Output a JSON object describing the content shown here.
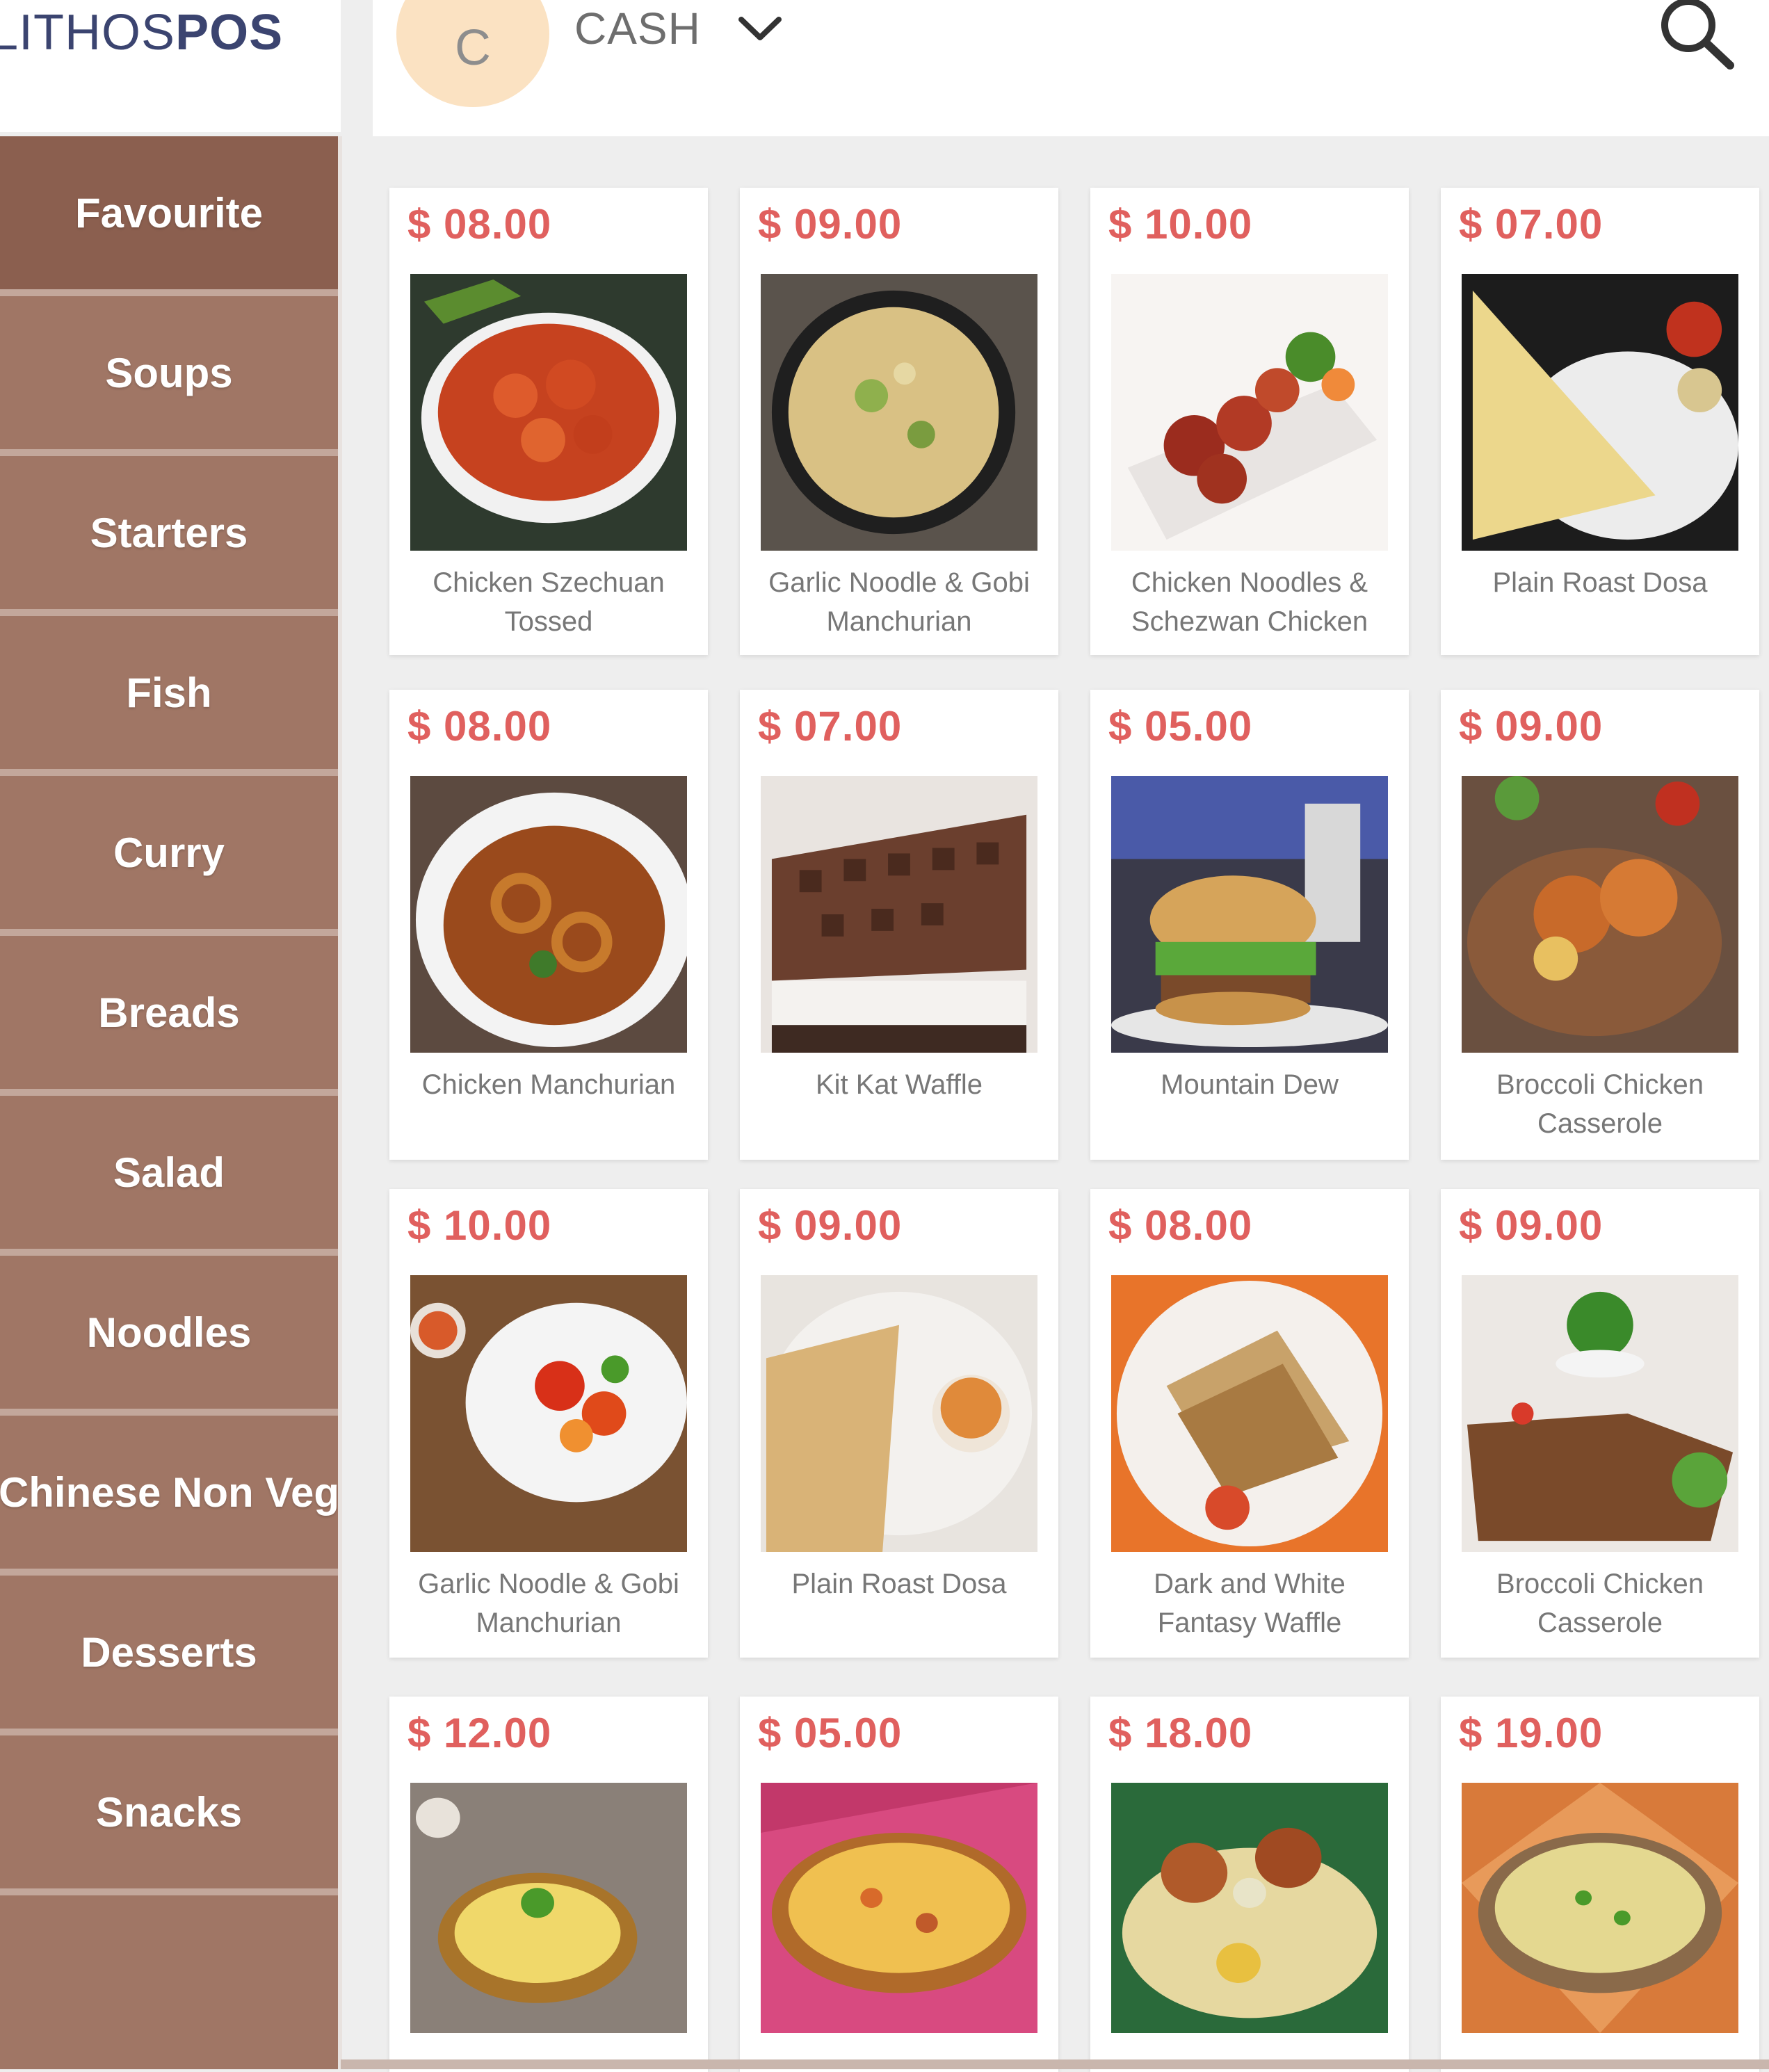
{
  "app": {
    "logo_light": "LITHOS",
    "logo_bold": "POS"
  },
  "header": {
    "avatar_letter": "C",
    "payment_mode": "CASH",
    "icons": {
      "dropdown": "chevron-down-icon",
      "search": "search-icon"
    }
  },
  "colors": {
    "sidebar": "#a07665",
    "sidebar_active": "#8b5f4f",
    "price": "#e0605e",
    "avatar": "#fbe2c2"
  },
  "categories": [
    {
      "label": "Favourite",
      "active": true
    },
    {
      "label": "Soups"
    },
    {
      "label": "Starters"
    },
    {
      "label": "Fish"
    },
    {
      "label": "Curry"
    },
    {
      "label": "Breads"
    },
    {
      "label": "Salad"
    },
    {
      "label": "Noodles"
    },
    {
      "label": "Chinese Non Veg"
    },
    {
      "label": "Desserts"
    },
    {
      "label": "Snacks"
    }
  ],
  "products": [
    {
      "price": "$ 08.00",
      "name": "Chicken Szechuan Tossed"
    },
    {
      "price": "$ 09.00",
      "name": "Garlic Noodle & Gobi Manchurian"
    },
    {
      "price": "$ 10.00",
      "name": "Chicken Noodles & Schezwan Chicken"
    },
    {
      "price": "$ 07.00",
      "name": "Plain Roast Dosa"
    },
    {
      "price": "$ 08.00",
      "name": "Chicken Manchurian"
    },
    {
      "price": "$ 07.00",
      "name": "Kit Kat Waffle"
    },
    {
      "price": "$ 05.00",
      "name": "Mountain Dew"
    },
    {
      "price": "$ 09.00",
      "name": "Broccoli Chicken Casserole"
    },
    {
      "price": "$ 10.00",
      "name": "Garlic Noodle & Gobi Manchurian"
    },
    {
      "price": "$ 09.00",
      "name": "Plain Roast Dosa"
    },
    {
      "price": "$ 08.00",
      "name": "Dark and White Fantasy Waffle"
    },
    {
      "price": "$ 09.00",
      "name": "Broccoli Chicken Casserole"
    },
    {
      "price": "$ 12.00",
      "name": ""
    },
    {
      "price": "$ 05.00",
      "name": ""
    },
    {
      "price": "$ 18.00",
      "name": ""
    },
    {
      "price": "$ 19.00",
      "name": ""
    }
  ]
}
